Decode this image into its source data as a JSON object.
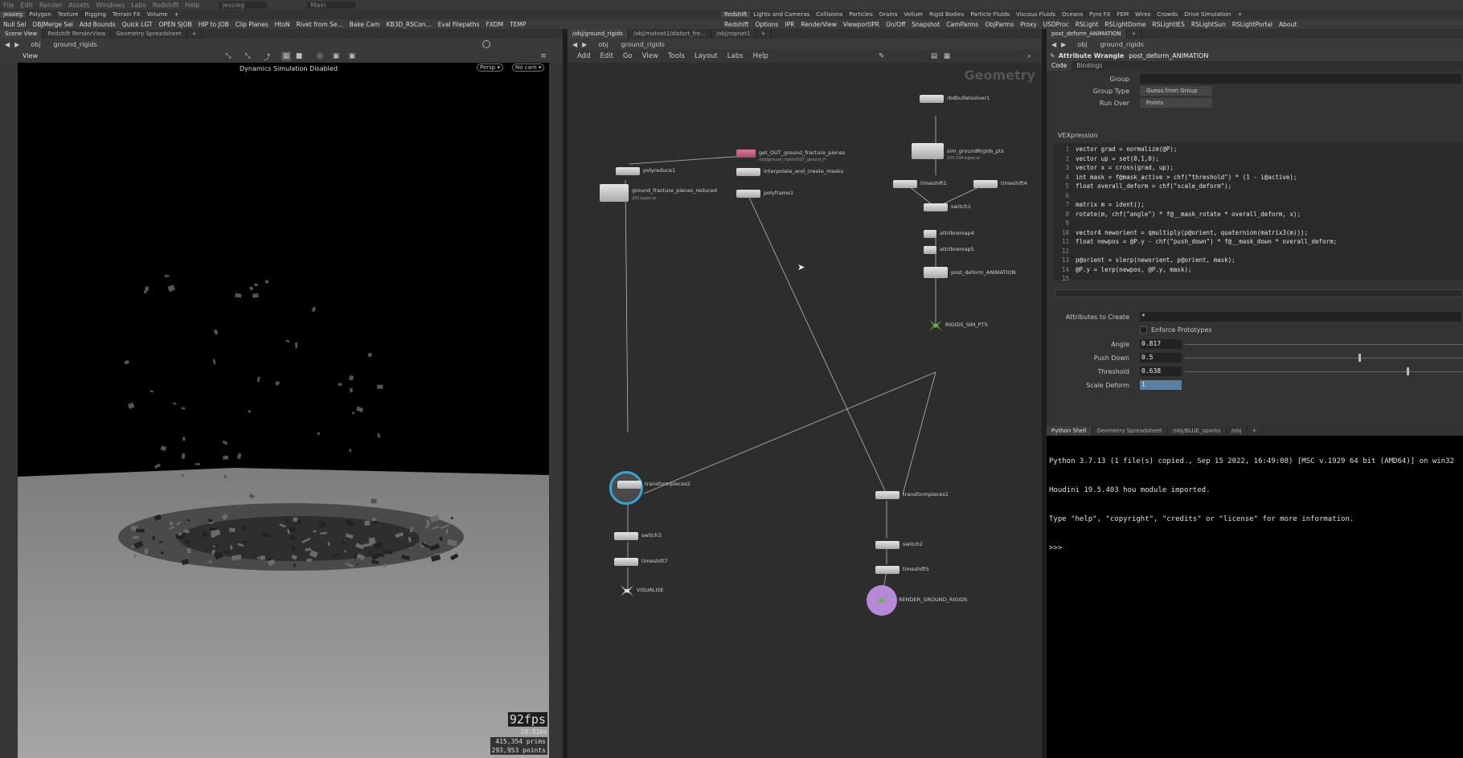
{
  "menubar": [
    "File",
    "Edit",
    "Render",
    "Assets",
    "Windows",
    "Labs",
    "Redshift",
    "Help",
    "jessieg",
    "Main"
  ],
  "shelf_tabs_left": [
    "jessieg",
    "Polygon",
    "Texture",
    "Rigging",
    "Terrain FX",
    "Volume",
    "+"
  ],
  "shelf_tabs_right": [
    "Redshift",
    "Lights and Cameras",
    "Collisions",
    "Particles",
    "Grains",
    "Vellum",
    "Rigid Bodies",
    "Particle Fluids",
    "Viscous Fluids",
    "Oceans",
    "Pyro FX",
    "FEM",
    "Wires",
    "Crowds",
    "Drive Simulation",
    "+"
  ],
  "shelf_buttons_left": [
    "Null Sel",
    "OBJMerge Sel",
    "Add Bounds",
    "Quick LGT",
    "OPEN SJOB",
    "HIP to JOB",
    "Clip Planes",
    "HtoN",
    "Rivet from Se...",
    "Bake Cam",
    "KB3D_RSCon...",
    "Eval Filepaths",
    "FXDM",
    "TEMP"
  ],
  "shelf_buttons_right": [
    "Redshift",
    "Options",
    "IPR",
    "RenderView",
    "ViewportIPR",
    "On/Off",
    "Snapshot",
    "CamParms",
    "ObjParms",
    "Proxy",
    "USDProc",
    "RSLight",
    "RSLightDome",
    "RSLightIES",
    "RSLightSun",
    "RSLightPortal",
    "About"
  ],
  "viewport": {
    "tabs": [
      "Scene View",
      "Redshift RenderView",
      "Geometry Spreadsheet",
      "+"
    ],
    "path": [
      "obj",
      "ground_rigids"
    ],
    "view_label": "View",
    "status": "Dynamics Simulation Disabled",
    "persp": "Persp ▾",
    "cam": "No cam ▾",
    "fps": "92fps",
    "ms": "10.81ms",
    "prims_count": "415,354",
    "prims_label": "prims",
    "points_count": "293,953",
    "points_label": "points"
  },
  "network": {
    "tabs": [
      "/obj/ground_rigids",
      "/obj/matnet1/distort_fre...",
      "/obj/ropnet1",
      "+"
    ],
    "path": [
      "obj",
      "ground_rigids"
    ],
    "menu": [
      "Add",
      "Edit",
      "Go",
      "View",
      "Tools",
      "Layout",
      "Labs",
      "Help"
    ],
    "context_label": "Geometry",
    "nodes": {
      "rbdbulletsolver1": "rbdbulletsolver1",
      "sim_groundRigids_pts": "sim_groundRigids_pts",
      "sim_sub": "205.194.bgeo.sc",
      "timeshift1": "timeshift1",
      "timeshift4": "timeshift4",
      "switch1": "switch1",
      "attribremap4": "attribremap4",
      "attribremap5": "attribremap5",
      "post_deform": "post_deform_ANIMATION",
      "rigids_sim_pts": "RIGIDS_SIM_PTS",
      "polyreduce1": "polyreduce1",
      "ground_fracture": "ground_fracture_pieces_reduced",
      "ground_sub": "205.bgeo.sc",
      "get_out": "get_OUT_ground_fracture_pieces",
      "get_out_sub": "/obj/ground_rigids/OUT_ground_fr",
      "interp": "interpolate_and_create_masks",
      "polyframe1": "polyframe1",
      "transformpieces2": "transformpieces2",
      "switch3": "switch3",
      "timeshift7": "timeshift7",
      "visualise": "VISUALISE",
      "transformpieces1": "transformpieces1",
      "switch2": "switch2",
      "timeshift5": "timeshift5",
      "render": "RENDER_GROUND_RIGIDS"
    }
  },
  "params": {
    "tabs": [
      "post_deform_ANIMATION",
      "+"
    ],
    "path": [
      "obj",
      "ground_rigids"
    ],
    "node_type": "Attribute Wrangle",
    "node_name": "post_deform_ANIMATION",
    "subtabs": [
      "Code",
      "Bindings"
    ],
    "group_label": "Group",
    "group_value": "",
    "group_type_label": "Group Type",
    "group_type_value": "Guess from Group",
    "run_over_label": "Run Over",
    "run_over_value": "Points",
    "vex_label": "VEXpression",
    "code_lines": [
      "vector grad = normalize(@P);",
      "vector up = set(0,1,0);",
      "vector x = cross(grad, up);",
      "int mask = f@mask_active > chf(\"threshold\") * (1 - i@active);",
      "float overall_deform = chf(\"scale_deform\");",
      "",
      "matrix m = ident();",
      "rotate(m, chf(\"angle\") * f@__mask_rotate * overall_deform, x);",
      "",
      "vector4 neworient = qmultiply(p@orient, quaternion(matrix3(m)));",
      "float newpos = @P.y - chf(\"push_down\") * f@__mask_down * overall_deform;",
      "",
      "p@orient = slerp(neworient, p@orient, mask);",
      "@P.y = lerp(newpos, @P.y, mask);",
      ""
    ],
    "attr_create_label": "Attributes to Create",
    "attr_create_value": "*",
    "enforce_label": "Enforce Prototypes",
    "angle_label": "Angle",
    "angle_value": "0.817",
    "push_label": "Push Down",
    "push_value": "0.5",
    "threshold_label": "Threshold",
    "threshold_value": "0.638",
    "scale_label": "Scale Deform",
    "scale_value": "1"
  },
  "console": {
    "tabs": [
      "Python Shell",
      "Geometry Spreadsheet",
      "/obj/BLUE_sparks",
      "/obj",
      "+"
    ],
    "lines": [
      "Python 3.7.13 (1 file(s) copied., Sep 15 2022, 16:49:08) [MSC v.1929 64 bit (AMD64)] on win32",
      "Houdini 19.5.403 hou module imported.",
      "Type \"help\", \"copyright\", \"credits\" or \"license\" for more information.",
      ">>>"
    ]
  },
  "colors": {
    "accent": "#4a7fb8",
    "render_flag": "#b78ad9",
    "display_flag": "#3aa3d6",
    "null_green": "#6fb04e"
  }
}
